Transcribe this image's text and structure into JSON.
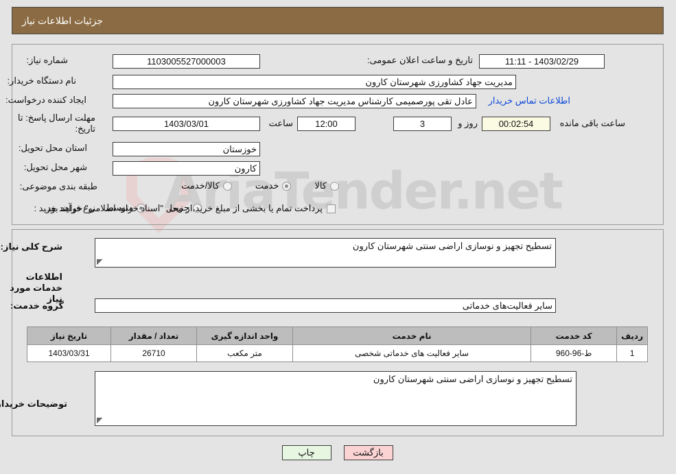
{
  "header": {
    "title": "جزئیات اطلاعات نیاز"
  },
  "watermark": {
    "text": "AriaTender.net"
  },
  "colors": {
    "header_bg": "#8b6b43",
    "page_bg": "#e4e4e4",
    "link": "#0b49d8",
    "table_header_bg": "#bdbdbd",
    "back_button_bg": "#fbd3d3",
    "print_button_bg": "#e7f6e1",
    "countdown_bg": "#fbfbe4"
  },
  "fields": {
    "need_number_label": "شماره نیاز:",
    "need_number_value": "1103005527000003",
    "public_announce_label": "تاریخ و ساعت اعلان عمومی:",
    "public_announce_value": "1403/02/29 - 11:11",
    "buyer_org_label": "نام دستگاه خریدار:",
    "buyer_org_value": "مدیریت جهاد کشاورزی شهرستان کارون",
    "creator_label": "ایجاد کننده درخواست:",
    "creator_value": "عادل تقی پورصمیمی کارشناس مدیریت جهاد کشاورزی شهرستان کارون",
    "contact_link": "اطلاعات تماس خریدار",
    "deadline_label": "مهلت ارسال پاسخ: تا تاریخ:",
    "deadline_date": "1403/03/01",
    "hour_label": "ساعت",
    "hour_value": "12:00",
    "days_value": "3",
    "days_unit": "روز و",
    "countdown_value": "00:02:54",
    "countdown_unit": "ساعت باقی مانده",
    "province_label": "استان محل تحویل:",
    "province_value": "خوزستان",
    "city_label": "شهر محل تحویل:",
    "city_value": "کارون",
    "category_label": "طبقه بندی موضوعی:",
    "process_type_label": "نوع فرآیند خرید :",
    "islamic_treasury_note": "پرداخت تمام یا بخشی از مبلغ خرید،از محل \"اسناد خزانه اسلامی\" خواهد بود.",
    "general_desc_label": "شرح کلی نیاز:",
    "general_desc_value": "تسطیح تجهیز و نوسازی اراضی سنتی شهرستان کارون",
    "services_heading": "اطلاعات خدمات مورد نیاز",
    "service_group_label": "گروه خدمت:",
    "service_group_value": "سایر فعالیت‌های خدماتی",
    "buyer_notes_label": "توضیحات خریدار:",
    "buyer_notes_value": "تسطیح تجهیز و نوسازی اراضی سنتی شهرستان کارون"
  },
  "category_options": [
    {
      "label": "کالا",
      "selected": false
    },
    {
      "label": "خدمت",
      "selected": true
    },
    {
      "label": "کالا/خدمت",
      "selected": false
    }
  ],
  "process_options": [
    {
      "label": "جزیی",
      "selected": false
    },
    {
      "label": "متوسط",
      "selected": true
    }
  ],
  "islamic_treasury_checked": false,
  "table": {
    "headers": [
      "ردیف",
      "کد خدمت",
      "نام خدمت",
      "واحد اندازه گیری",
      "تعداد / مقدار",
      "تاریخ نیاز"
    ],
    "rows": [
      {
        "radif": "1",
        "code": "ط-96-960",
        "name": "سایر فعالیت های خدماتی شخصی",
        "unit": "متر مکعب",
        "quantity": "26710",
        "need_date": "1403/03/31"
      }
    ]
  },
  "buttons": {
    "back": "بازگشت",
    "print": "چاپ"
  }
}
